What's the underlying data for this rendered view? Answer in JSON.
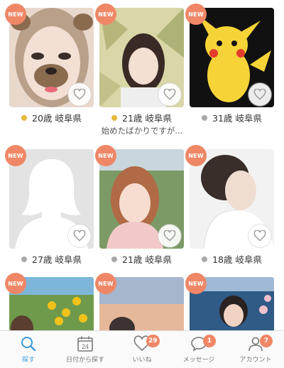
{
  "profiles": [
    {
      "badge": "NEW",
      "age": "20歳",
      "location": "岐阜県",
      "status": "online"
    },
    {
      "badge": "NEW",
      "age": "21歳",
      "location": "岐阜県",
      "status": "online"
    },
    {
      "badge": "NEW",
      "age": "31歳",
      "location": "岐阜県",
      "status": "offline"
    },
    {
      "badge": "NEW",
      "age": "27歳",
      "location": "岐阜県",
      "status": "offline"
    },
    {
      "badge": "NEW",
      "age": "21歳",
      "location": "岐阜県",
      "status": "offline"
    },
    {
      "badge": "NEW",
      "age": "18歳",
      "location": "岐阜県",
      "status": "offline"
    },
    {
      "badge": "NEW"
    },
    {
      "badge": "NEW"
    },
    {
      "badge": "NEW"
    }
  ],
  "comment": "始めたばかりですが...",
  "tabs": [
    {
      "label": "探す",
      "icon": "search-icon",
      "active": true
    },
    {
      "label": "日付から探す",
      "icon": "calendar-icon",
      "day": "24"
    },
    {
      "label": "いいね",
      "icon": "heart-icon",
      "count": "29"
    },
    {
      "label": "メッセージ",
      "icon": "chat-bubble-icon",
      "count": "1"
    },
    {
      "label": "アカウント",
      "icon": "person-icon",
      "count": "7"
    }
  ],
  "colors": {
    "accent": "#3a9ad9",
    "badge": "#ef8766",
    "online": "#e6b93a",
    "offline": "#a9a9a9"
  }
}
